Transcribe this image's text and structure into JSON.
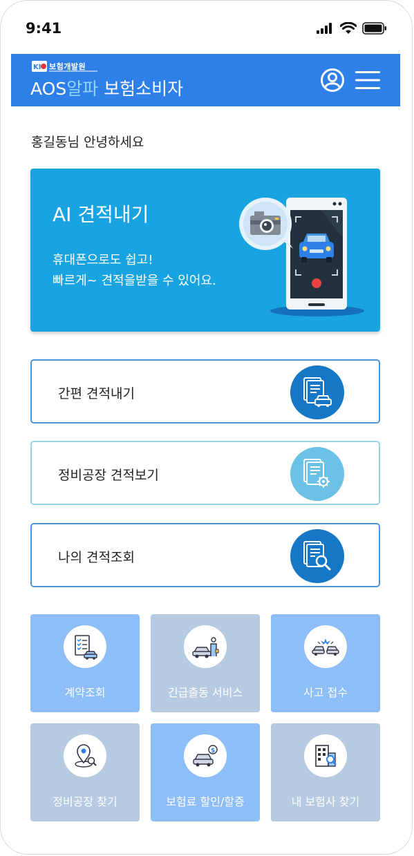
{
  "status_bar": {
    "time": "9:41",
    "icons": [
      "signal-icon",
      "wifi-icon",
      "battery-icon"
    ]
  },
  "header": {
    "org_name": "보험개발원",
    "title_aos": "AOS",
    "title_alpha": "알파",
    "title_rest": " 보험소비자",
    "bg_color": "#2f7fe8",
    "profile_icon": "user-circle-icon",
    "menu_icon": "hamburger-menu-icon"
  },
  "greeting": "홍길동님 안녕하세요",
  "ai_card": {
    "title": "AI 견적내기",
    "desc_line1": "휴대폰으로도 쉽고!",
    "desc_line2": "빠르게~ 견적을받을 수 있어요.",
    "bg_color": "#19a4e1"
  },
  "list_buttons": [
    {
      "label": "간편 견적내기",
      "icon": "document-car-icon",
      "icon_bg": "#1577c6"
    },
    {
      "label": "정비공장 견적보기",
      "icon": "document-gear-icon",
      "icon_bg": "#6cc1e7"
    },
    {
      "label": "나의 견적조회",
      "icon": "document-search-icon",
      "icon_bg": "#1577c6"
    }
  ],
  "tiles": [
    {
      "label": "계약조회",
      "icon": "contract-checklist-icon",
      "color": "#8dbef7"
    },
    {
      "label": "긴급출동 서비스",
      "icon": "roadside-assistance-icon",
      "color": "#b6cbe1"
    },
    {
      "label": "사고 접수",
      "icon": "car-accident-icon",
      "color": "#8dbef7"
    },
    {
      "label": "정비공장 찾기",
      "icon": "location-search-icon",
      "color": "#b6cbe1"
    },
    {
      "label": "보험료 할인/할증",
      "icon": "car-price-icon",
      "color": "#8dbef7"
    },
    {
      "label": "내 보험사 찾기",
      "icon": "building-search-icon",
      "color": "#b6cbe1"
    }
  ]
}
